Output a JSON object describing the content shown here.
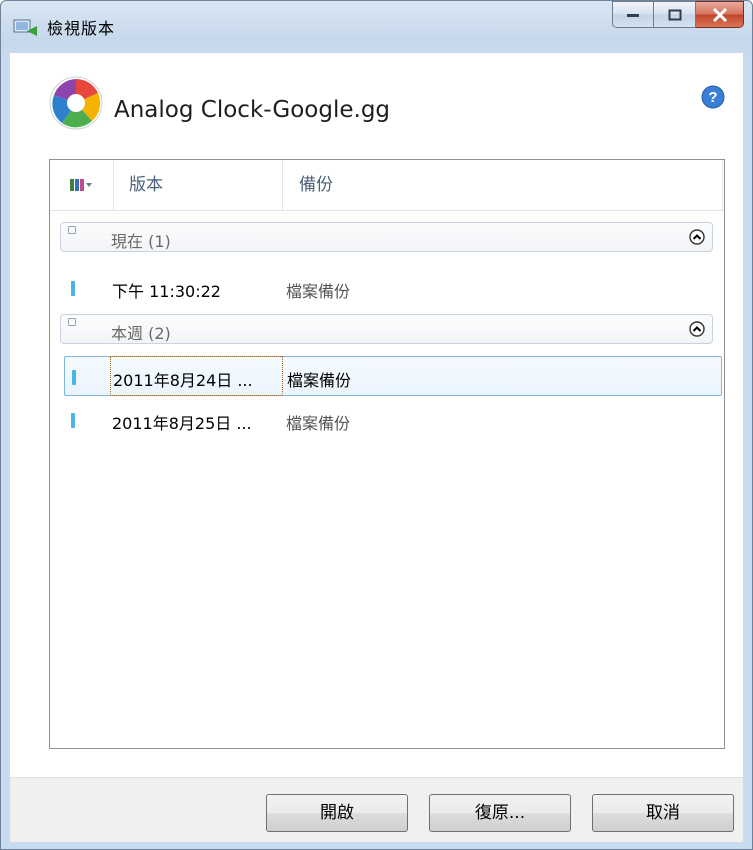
{
  "window": {
    "title": "檢視版本",
    "icon": "restore-version-icon",
    "caption_buttons": [
      "minimize-icon",
      "maximize-icon",
      "close-icon"
    ]
  },
  "header": {
    "file_name": "Analog Clock-Google.gg",
    "app_icon": "picasa-logo-icon",
    "help_icon": "help-icon"
  },
  "list": {
    "columns": [
      {
        "label": "版本"
      },
      {
        "label": "備份"
      }
    ],
    "groups": [
      {
        "label": "現在 (1)",
        "rows": [
          {
            "version": "下午 11:30:22",
            "type": "檔案備份"
          }
        ]
      },
      {
        "label": "本週 (2)",
        "rows": [
          {
            "version": "2011年8月24日 ...",
            "type": "檔案備份",
            "selected": true
          },
          {
            "version": "2011年8月25日 ...",
            "type": "檔案備份"
          }
        ]
      }
    ]
  },
  "footer": {
    "open_label": "開啟",
    "restore_label": "復原...",
    "cancel_label": "取消"
  },
  "colors": {
    "row_marker": "#48b4e8",
    "selection_border": "#7db6e6",
    "close_button": "#c0442a"
  }
}
